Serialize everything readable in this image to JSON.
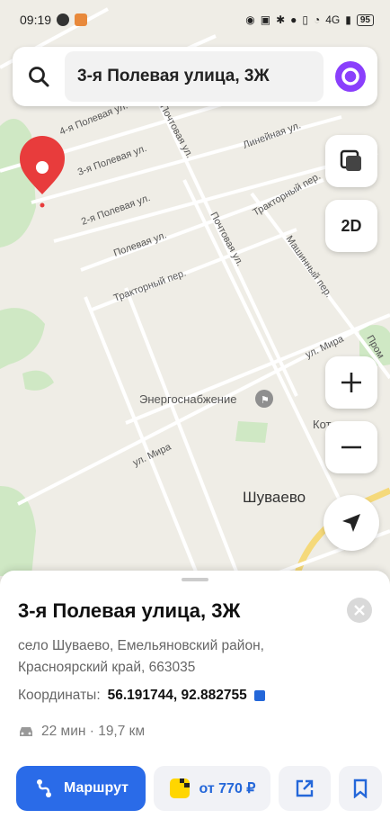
{
  "status_bar": {
    "time": "09:19",
    "battery": "95",
    "network": "4G"
  },
  "search": {
    "query": "3-я Полевая улица, 3Ж"
  },
  "map": {
    "streets": [
      "4-я Полевая ул.",
      "3-я Полевая ул.",
      "2-я Полевая ул.",
      "Полевая ул.",
      "Тракторный пер.",
      "Почтовая ул.",
      "Почтовая ул.",
      "Линейная ул.",
      "Тракторный пер.",
      "Машинный пер.",
      "ул. Мира",
      "ул. Мира",
      "Пром"
    ],
    "poi_energy": "Энергоснабжение",
    "poi_boiler": "Котельная",
    "locality": "Шуваево",
    "view_mode": "2D"
  },
  "place": {
    "title": "3-я Полевая улица, 3Ж",
    "address": "село Шуваево, Емельяновский район, Красноярский край, 663035",
    "coords_label": "Координаты:",
    "coords_value": "56.191744, 92.882755",
    "drive_text": "22 мин · 19,7 км"
  },
  "buttons": {
    "route": "Маршрут",
    "taxi": "от 770 ₽"
  },
  "colors": {
    "accent": "#2a6be8",
    "pin": "#e83c3c",
    "alice": "#8a3ffc",
    "taxi": "#ffd600"
  }
}
